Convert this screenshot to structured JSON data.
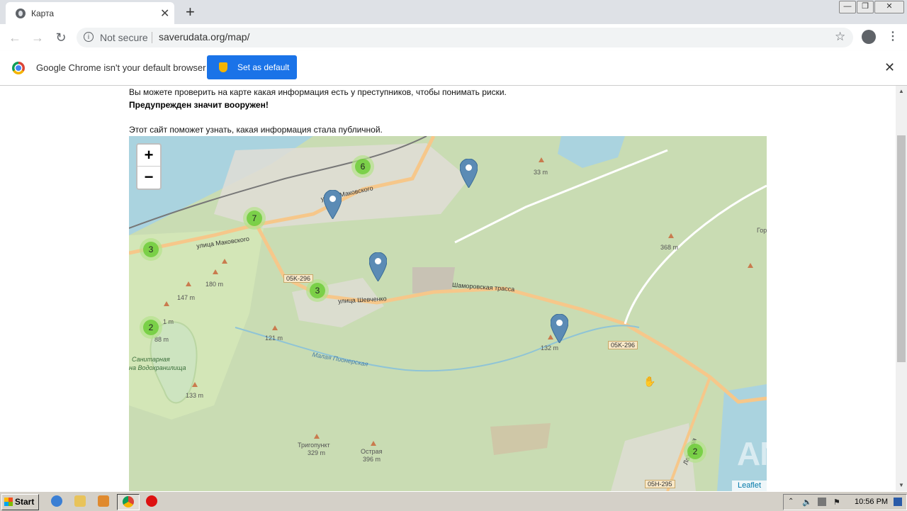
{
  "browser": {
    "tab_title": "Карта",
    "tab_close": "✕",
    "new_tab": "+",
    "security_label": "Not secure",
    "url": "saverudata.org/map/",
    "infobar_message": "Google Chrome isn't your default browser",
    "infobar_button": "Set as default"
  },
  "page": {
    "line1": "Вы можете проверить на карте какая информация есть у преступников, чтобы понимать риски.",
    "line2": "Предупрежден значит вооружен!",
    "line3": "Этот сайт поможет узнать, какая информация стала публичной."
  },
  "map": {
    "zoom_in": "+",
    "zoom_out": "−",
    "attribution": "Leaflet",
    "clusters": [
      "6",
      "7",
      "3",
      "3",
      "2",
      "2"
    ],
    "labels": {
      "street_makovskogo_1": "улица Маковского",
      "street_makovskogo_2": "улица Маковского",
      "road_05k_1": "05K-296",
      "road_05k_2": "05K-296",
      "road_05h": "05H-295",
      "street_shevchenko": "улица Шевченко",
      "shamorovskaya": "Шаморовская трасса",
      "river": "Малая Пионерская",
      "sanitary_1": "Санитарная",
      "sanitary_2": "на Водохранилища",
      "lazurnaya": "Лазурная",
      "gor": "Гор",
      "trigopunkt": "Тригопункт",
      "trigopunkt_h": "329 m",
      "ostraya": "Острая",
      "ostraya_h": "396 m",
      "h33": "33 m",
      "h368": "368 m",
      "h180": "180 m",
      "h147": "147 m",
      "h1": "1 m",
      "h88": "88 m",
      "h121": "121 m",
      "h132": "132 m",
      "h133": "133 m"
    }
  },
  "taskbar": {
    "start": "Start",
    "clock": "10:56 PM"
  },
  "watermark": "ANY▷RUN",
  "colors": {
    "map_bg": "#c9dcb3",
    "water": "#aad3df",
    "road": "#f6c78a",
    "cluster": "#6ecc39",
    "pin": "#5b8bb5",
    "button_blue": "#1a73e8"
  }
}
